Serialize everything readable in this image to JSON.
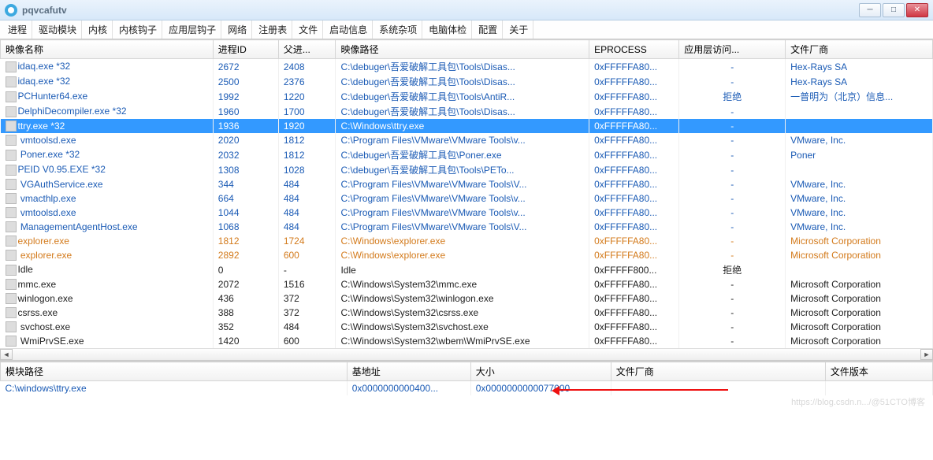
{
  "window": {
    "title": "pqvcafutv"
  },
  "menu": [
    "进程",
    "驱动模块",
    "内核",
    "内核钩子",
    "应用层钩子",
    "网络",
    "注册表",
    "文件",
    "启动信息",
    "系统杂项",
    "电脑体检",
    "配置",
    "关于"
  ],
  "procCols": [
    "映像名称",
    "进程ID",
    "父进...",
    "映像路径",
    "EPROCESS",
    "应用层访问...",
    "文件厂商"
  ],
  "procWidths": [
    260,
    80,
    70,
    310,
    110,
    130,
    180
  ],
  "procs": [
    {
      "c": "blue",
      "n": "idaq.exe *32",
      "pid": "2672",
      "ppid": "2408",
      "path": "C:\\debuger\\吾爱破解工具包\\Tools\\Disas...",
      "ep": "0xFFFFFA80...",
      "acc": "-",
      "ven": "Hex-Rays SA"
    },
    {
      "c": "blue",
      "n": "idaq.exe *32",
      "pid": "2500",
      "ppid": "2376",
      "path": "C:\\debuger\\吾爱破解工具包\\Tools\\Disas...",
      "ep": "0xFFFFFA80...",
      "acc": "-",
      "ven": "Hex-Rays SA"
    },
    {
      "c": "blue",
      "n": "PCHunter64.exe",
      "pid": "1992",
      "ppid": "1220",
      "path": "C:\\debuger\\吾爱破解工具包\\Tools\\AntiR...",
      "ep": "0xFFFFFA80...",
      "acc": "拒绝",
      "ven": "一普明为（北京）信息..."
    },
    {
      "c": "blue",
      "n": "DelphiDecompiler.exe *32",
      "pid": "1960",
      "ppid": "1700",
      "path": "C:\\debuger\\吾爱破解工具包\\Tools\\Disas...",
      "ep": "0xFFFFFA80...",
      "acc": "-",
      "ven": ""
    },
    {
      "c": "sel",
      "n": "ttry.exe *32",
      "pid": "1936",
      "ppid": "1920",
      "path": "C:\\Windows\\ttry.exe",
      "ep": "0xFFFFFA80...",
      "acc": "-",
      "ven": ""
    },
    {
      "c": "blue",
      "n": "    vmtoolsd.exe",
      "pid": "2020",
      "ppid": "1812",
      "path": "C:\\Program Files\\VMware\\VMware Tools\\v...",
      "ep": "0xFFFFFA80...",
      "acc": "-",
      "ven": "VMware, Inc."
    },
    {
      "c": "blue",
      "n": "    Poner.exe *32",
      "pid": "2032",
      "ppid": "1812",
      "path": "C:\\debuger\\吾爱破解工具包\\Poner.exe",
      "ep": "0xFFFFFA80...",
      "acc": "-",
      "ven": "Poner"
    },
    {
      "c": "blue",
      "n": "PEID V0.95.EXE *32",
      "pid": "1308",
      "ppid": "1028",
      "path": "C:\\debuger\\吾爱破解工具包\\Tools\\PETo...",
      "ep": "0xFFFFFA80...",
      "acc": "-",
      "ven": ""
    },
    {
      "c": "blue",
      "n": "    VGAuthService.exe",
      "pid": "344",
      "ppid": "484",
      "path": "C:\\Program Files\\VMware\\VMware Tools\\V...",
      "ep": "0xFFFFFA80...",
      "acc": "-",
      "ven": "VMware, Inc."
    },
    {
      "c": "blue",
      "n": "    vmacthlp.exe",
      "pid": "664",
      "ppid": "484",
      "path": "C:\\Program Files\\VMware\\VMware Tools\\v...",
      "ep": "0xFFFFFA80...",
      "acc": "-",
      "ven": "VMware, Inc."
    },
    {
      "c": "blue",
      "n": "    vmtoolsd.exe",
      "pid": "1044",
      "ppid": "484",
      "path": "C:\\Program Files\\VMware\\VMware Tools\\v...",
      "ep": "0xFFFFFA80...",
      "acc": "-",
      "ven": "VMware, Inc."
    },
    {
      "c": "blue",
      "n": "    ManagementAgentHost.exe",
      "pid": "1068",
      "ppid": "484",
      "path": "C:\\Program Files\\VMware\\VMware Tools\\V...",
      "ep": "0xFFFFFA80...",
      "acc": "-",
      "ven": "VMware, Inc."
    },
    {
      "c": "orange",
      "n": "explorer.exe",
      "pid": "1812",
      "ppid": "1724",
      "path": "C:\\Windows\\explorer.exe",
      "ep": "0xFFFFFA80...",
      "acc": "-",
      "ven": "Microsoft Corporation"
    },
    {
      "c": "orange",
      "n": "        explorer.exe",
      "pid": "2892",
      "ppid": "600",
      "path": "C:\\Windows\\explorer.exe",
      "ep": "0xFFFFFA80...",
      "acc": "-",
      "ven": "Microsoft Corporation"
    },
    {
      "c": "black",
      "n": "Idle",
      "pid": "0",
      "ppid": "-",
      "path": "Idle",
      "ep": "0xFFFFF800...",
      "acc": "拒绝",
      "ven": ""
    },
    {
      "c": "black",
      "n": "mmc.exe",
      "pid": "2072",
      "ppid": "1516",
      "path": "C:\\Windows\\System32\\mmc.exe",
      "ep": "0xFFFFFA80...",
      "acc": "-",
      "ven": "Microsoft Corporation"
    },
    {
      "c": "black",
      "n": "winlogon.exe",
      "pid": "436",
      "ppid": "372",
      "path": "C:\\Windows\\System32\\winlogon.exe",
      "ep": "0xFFFFFA80...",
      "acc": "-",
      "ven": "Microsoft Corporation"
    },
    {
      "c": "black",
      "n": "csrss.exe",
      "pid": "388",
      "ppid": "372",
      "path": "C:\\Windows\\System32\\csrss.exe",
      "ep": "0xFFFFFA80...",
      "acc": "-",
      "ven": "Microsoft Corporation"
    },
    {
      "c": "black",
      "n": "    svchost.exe",
      "pid": "352",
      "ppid": "484",
      "path": "C:\\Windows\\System32\\svchost.exe",
      "ep": "0xFFFFFA80...",
      "acc": "-",
      "ven": "Microsoft Corporation"
    },
    {
      "c": "black",
      "n": "    WmiPrvSE.exe",
      "pid": "1420",
      "ppid": "600",
      "path": "C:\\Windows\\System32\\wbem\\WmiPrvSE.exe",
      "ep": "0xFFFFFA80...",
      "acc": "-",
      "ven": "Microsoft Corporation"
    }
  ],
  "modCols": [
    "模块路径",
    "基地址",
    "大小",
    "文件厂商",
    "文件版本"
  ],
  "modWidths": [
    420,
    150,
    170,
    260,
    130
  ],
  "mods": [
    {
      "path": "C:\\windows\\ttry.exe",
      "base": "0x0000000000400...",
      "size": "0x0000000000077000",
      "ven": "",
      "ver": ""
    }
  ],
  "watermark": "https://blog.csdn.n.../@51CTO博客"
}
